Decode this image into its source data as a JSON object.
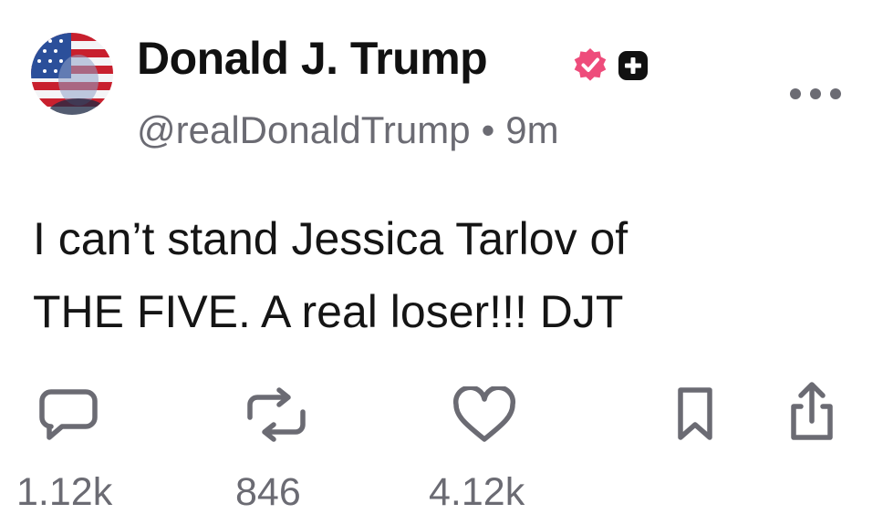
{
  "post": {
    "author": {
      "display_name": "Donald J. Trump",
      "handle": "@realDonaldTrump",
      "verified_badge_icon": "verified-check-icon",
      "verified_badge_color": "#ee4c7b",
      "plus_badge_icon": "plus-square-icon"
    },
    "separator": "•",
    "time_ago": "9m",
    "text_lines": [
      "I can’t stand Jessica Tarlov of",
      "THE FIVE. A real loser!!! DJT"
    ]
  },
  "actions": {
    "reply": {
      "icon": "comment-icon",
      "count": "1.12k"
    },
    "retruth": {
      "icon": "repost-icon",
      "count": "846"
    },
    "like": {
      "icon": "heart-icon",
      "count": "4.12k"
    },
    "bookmark": {
      "icon": "bookmark-icon"
    },
    "share": {
      "icon": "share-icon"
    }
  },
  "colors": {
    "text": "#111111",
    "muted": "#6b6b73",
    "icon": "#6b6b73"
  }
}
